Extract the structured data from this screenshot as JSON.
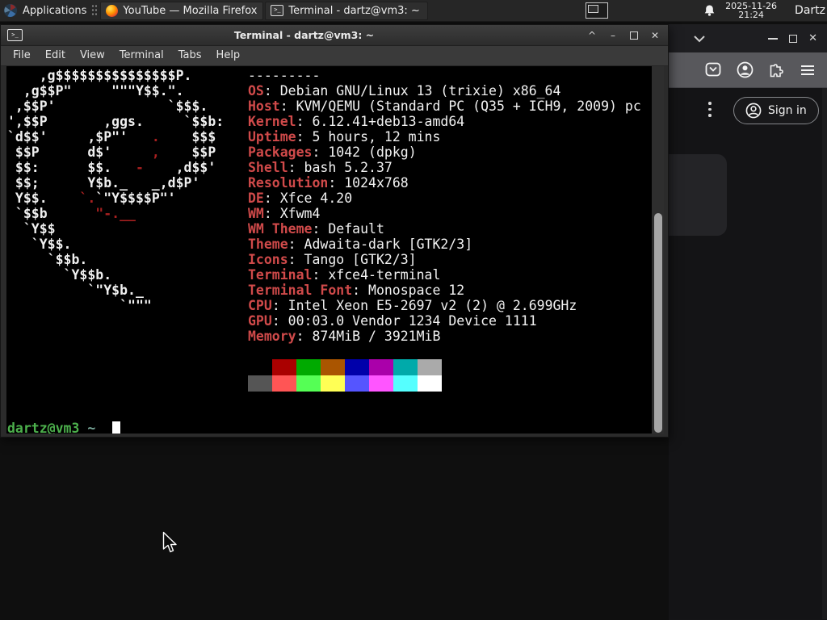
{
  "taskbar": {
    "applications_label": "Applications",
    "tasks": [
      {
        "title": "YouTube — Mozilla Firefox"
      },
      {
        "title": "Terminal - dartz@vm3: ~"
      }
    ],
    "clock_date": "2025-11-26",
    "clock_time": "21:24",
    "user_label": "Dartz"
  },
  "terminal_window": {
    "title": "Terminal - dartz@vm3: ~",
    "menu_items": [
      "File",
      "Edit",
      "View",
      "Terminal",
      "Tabs",
      "Help"
    ],
    "controls": {
      "shade": "^",
      "minimize": "–",
      "close": "✕"
    }
  },
  "terminal": {
    "header_dashes": "---------",
    "ascii_art": [
      [
        {
          "t": "    ,g$$$$$$$$$$$$$$$P.",
          "c": "f"
        }
      ],
      [
        {
          "t": "  ,g$$P\"     \"\"\"Y$$.\".",
          "c": "f"
        }
      ],
      [
        {
          "t": " ,$$P'              `$$$.",
          "c": "f"
        }
      ],
      [
        {
          "t": "',$$P       ,ggs.     `$$b:",
          "c": "f"
        }
      ],
      [
        {
          "t": "`d$$'     ,$P\"'   ",
          "c": "f"
        },
        {
          "t": ".",
          "c": "r"
        },
        {
          "t": "    $$$",
          "c": "f"
        }
      ],
      [
        {
          "t": " $$P      d$'     ",
          "c": "f"
        },
        {
          "t": ",",
          "c": "r"
        },
        {
          "t": "    $$P",
          "c": "f"
        }
      ],
      [
        {
          "t": " $$:      $$.   ",
          "c": "f"
        },
        {
          "t": "-",
          "c": "r"
        },
        {
          "t": "    ,d$$'",
          "c": "f"
        }
      ],
      [
        {
          "t": " $$;      Y$b._   _,d$P'",
          "c": "f"
        }
      ],
      [
        {
          "t": " Y$$.    ",
          "c": "f"
        },
        {
          "t": "`.",
          "c": "r"
        },
        {
          "t": "`\"Y$$$$P\"'",
          "c": "f"
        }
      ],
      [
        {
          "t": " `$$b      ",
          "c": "f"
        },
        {
          "t": "\"-.__",
          "c": "r"
        }
      ],
      [
        {
          "t": "  `Y$$",
          "c": "f"
        }
      ],
      [
        {
          "t": "   `Y$$.",
          "c": "f"
        }
      ],
      [
        {
          "t": "     `$$b.",
          "c": "f"
        }
      ],
      [
        {
          "t": "       `Y$$b.",
          "c": "f"
        }
      ],
      [
        {
          "t": "          `\"Y$b._",
          "c": "f"
        }
      ],
      [
        {
          "t": "              `\"\"\"",
          "c": "f"
        }
      ]
    ],
    "info": [
      {
        "label": "OS",
        "value": "Debian GNU/Linux 13 (trixie) x86_64"
      },
      {
        "label": "Host",
        "value": "KVM/QEMU (Standard PC (Q35 + ICH9, 2009) pc"
      },
      {
        "label": "Kernel",
        "value": "6.12.41+deb13-amd64"
      },
      {
        "label": "Uptime",
        "value": "5 hours, 12 mins"
      },
      {
        "label": "Packages",
        "value": "1042 (dpkg)"
      },
      {
        "label": "Shell",
        "value": "bash 5.2.37"
      },
      {
        "label": "Resolution",
        "value": "1024x768"
      },
      {
        "label": "DE",
        "value": "Xfce 4.20"
      },
      {
        "label": "WM",
        "value": "Xfwm4"
      },
      {
        "label": "WM Theme",
        "value": "Default"
      },
      {
        "label": "Theme",
        "value": "Adwaita-dark [GTK2/3]"
      },
      {
        "label": "Icons",
        "value": "Tango [GTK2/3]"
      },
      {
        "label": "Terminal",
        "value": "xfce4-terminal"
      },
      {
        "label": "Terminal Font",
        "value": "Monospace 12"
      },
      {
        "label": "CPU",
        "value": "Intel Xeon E5-2697 v2 (2) @ 2.699GHz"
      },
      {
        "label": "GPU",
        "value": "00:03.0 Vendor 1234 Device 1111"
      },
      {
        "label": "Memory",
        "value": "874MiB / 3921MiB"
      }
    ],
    "palette": [
      [
        "#000000",
        "#aa0000",
        "#00aa00",
        "#aa5500",
        "#0000aa",
        "#aa00aa",
        "#00aaaa",
        "#aaaaaa"
      ],
      [
        "#555555",
        "#ff5555",
        "#55ff55",
        "#ffff55",
        "#5555ff",
        "#ff55ff",
        "#55ffff",
        "#ffffff"
      ]
    ],
    "prompt": {
      "user_host": "dartz@vm3",
      "colon": ":",
      "path": "~",
      "dollar": "$"
    },
    "colors": {
      "label_red": "#d04a4a",
      "art_red": "#a82020",
      "prompt_green": "#4cb04c",
      "prompt_path_blue": "#79a89a"
    }
  },
  "firefox": {
    "signin_label": "Sign in"
  }
}
